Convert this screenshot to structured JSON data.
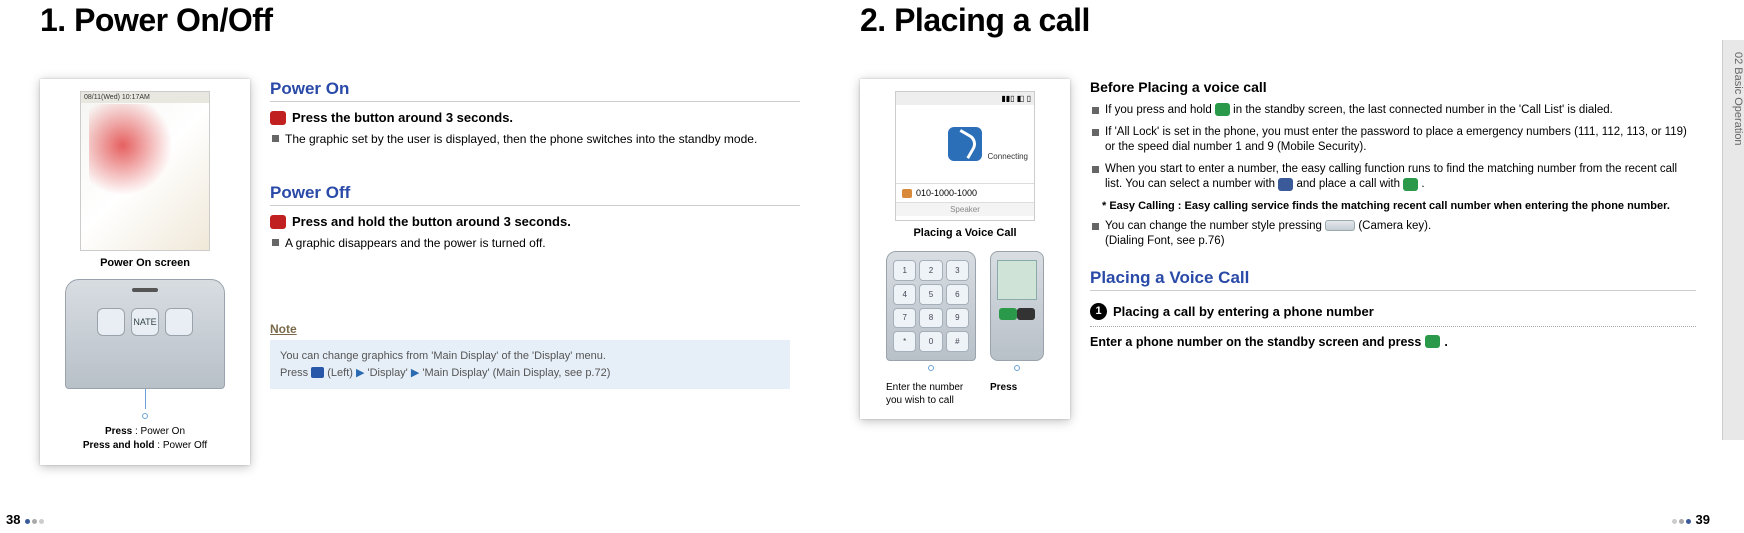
{
  "left": {
    "heading": "1. Power On/Off",
    "phone_status": "08/11(Wed) 10:17AM",
    "caption": "Power On screen",
    "press": "Press",
    "press_action": " : Power On",
    "press_hold": "Press and hold",
    "press_hold_action": " : Power Off",
    "power_on": {
      "title": "Power On",
      "instr": "Press the button around 3 seconds.",
      "bullet": "The graphic set by the user is displayed, then the phone switches into the standby mode."
    },
    "power_off": {
      "title": "Power Off",
      "instr": "Press and hold the button around 3 seconds.",
      "bullet": "A graphic disappears and the power is turned off."
    },
    "note_label": "Note",
    "note_l1": "You can change graphics from 'Main Display' of the 'Display' menu.",
    "note_l2a": "Press ",
    "note_l2b": " (Left) ",
    "note_l2c": " 'Display' ",
    "note_l2d": " 'Main Display' (Main Display, see p.72)"
  },
  "right": {
    "heading": "2. Placing a call",
    "before_title": "Before Placing a voice call",
    "b1a": "If you press and hold ",
    "b1b": " in the standby screen, the last connected number in the 'Call List' is dialed.",
    "b2": "If 'All Lock' is set in the phone, you must enter the password to place a emergency numbers (111, 112, 113, or 119) or the speed dial number 1 and 9 (Mobile Security).",
    "b3a": "When you start to enter a number, the easy calling function runs to find the matching number from the recent call list. You can select a number with ",
    "b3b": " and place a call with ",
    "b3c": ".",
    "easy": "* Easy Calling : Easy calling service finds the matching recent call number when entering the phone number.",
    "b4a": "You can change the number style pressing ",
    "b4b": " (Camera key).",
    "b4c": "(Dialing Font, see p.76)",
    "placing_title": "Placing a Voice Call",
    "step_num": "1",
    "step_title": "Placing a call by entering a phone number",
    "step_body_a": "Enter a phone number on the standby screen and press ",
    "step_body_b": " .",
    "screen_caption": "Placing a Voice Call",
    "call_connecting": "Connecting",
    "call_number": "010-1000-1000",
    "call_speaker": "Speaker",
    "kp_caption1": "Enter the number you wish to call",
    "kp_caption2": "Press",
    "side_tab": "02  Basic Operation"
  },
  "page_left_num": "38",
  "page_right_num": "39"
}
